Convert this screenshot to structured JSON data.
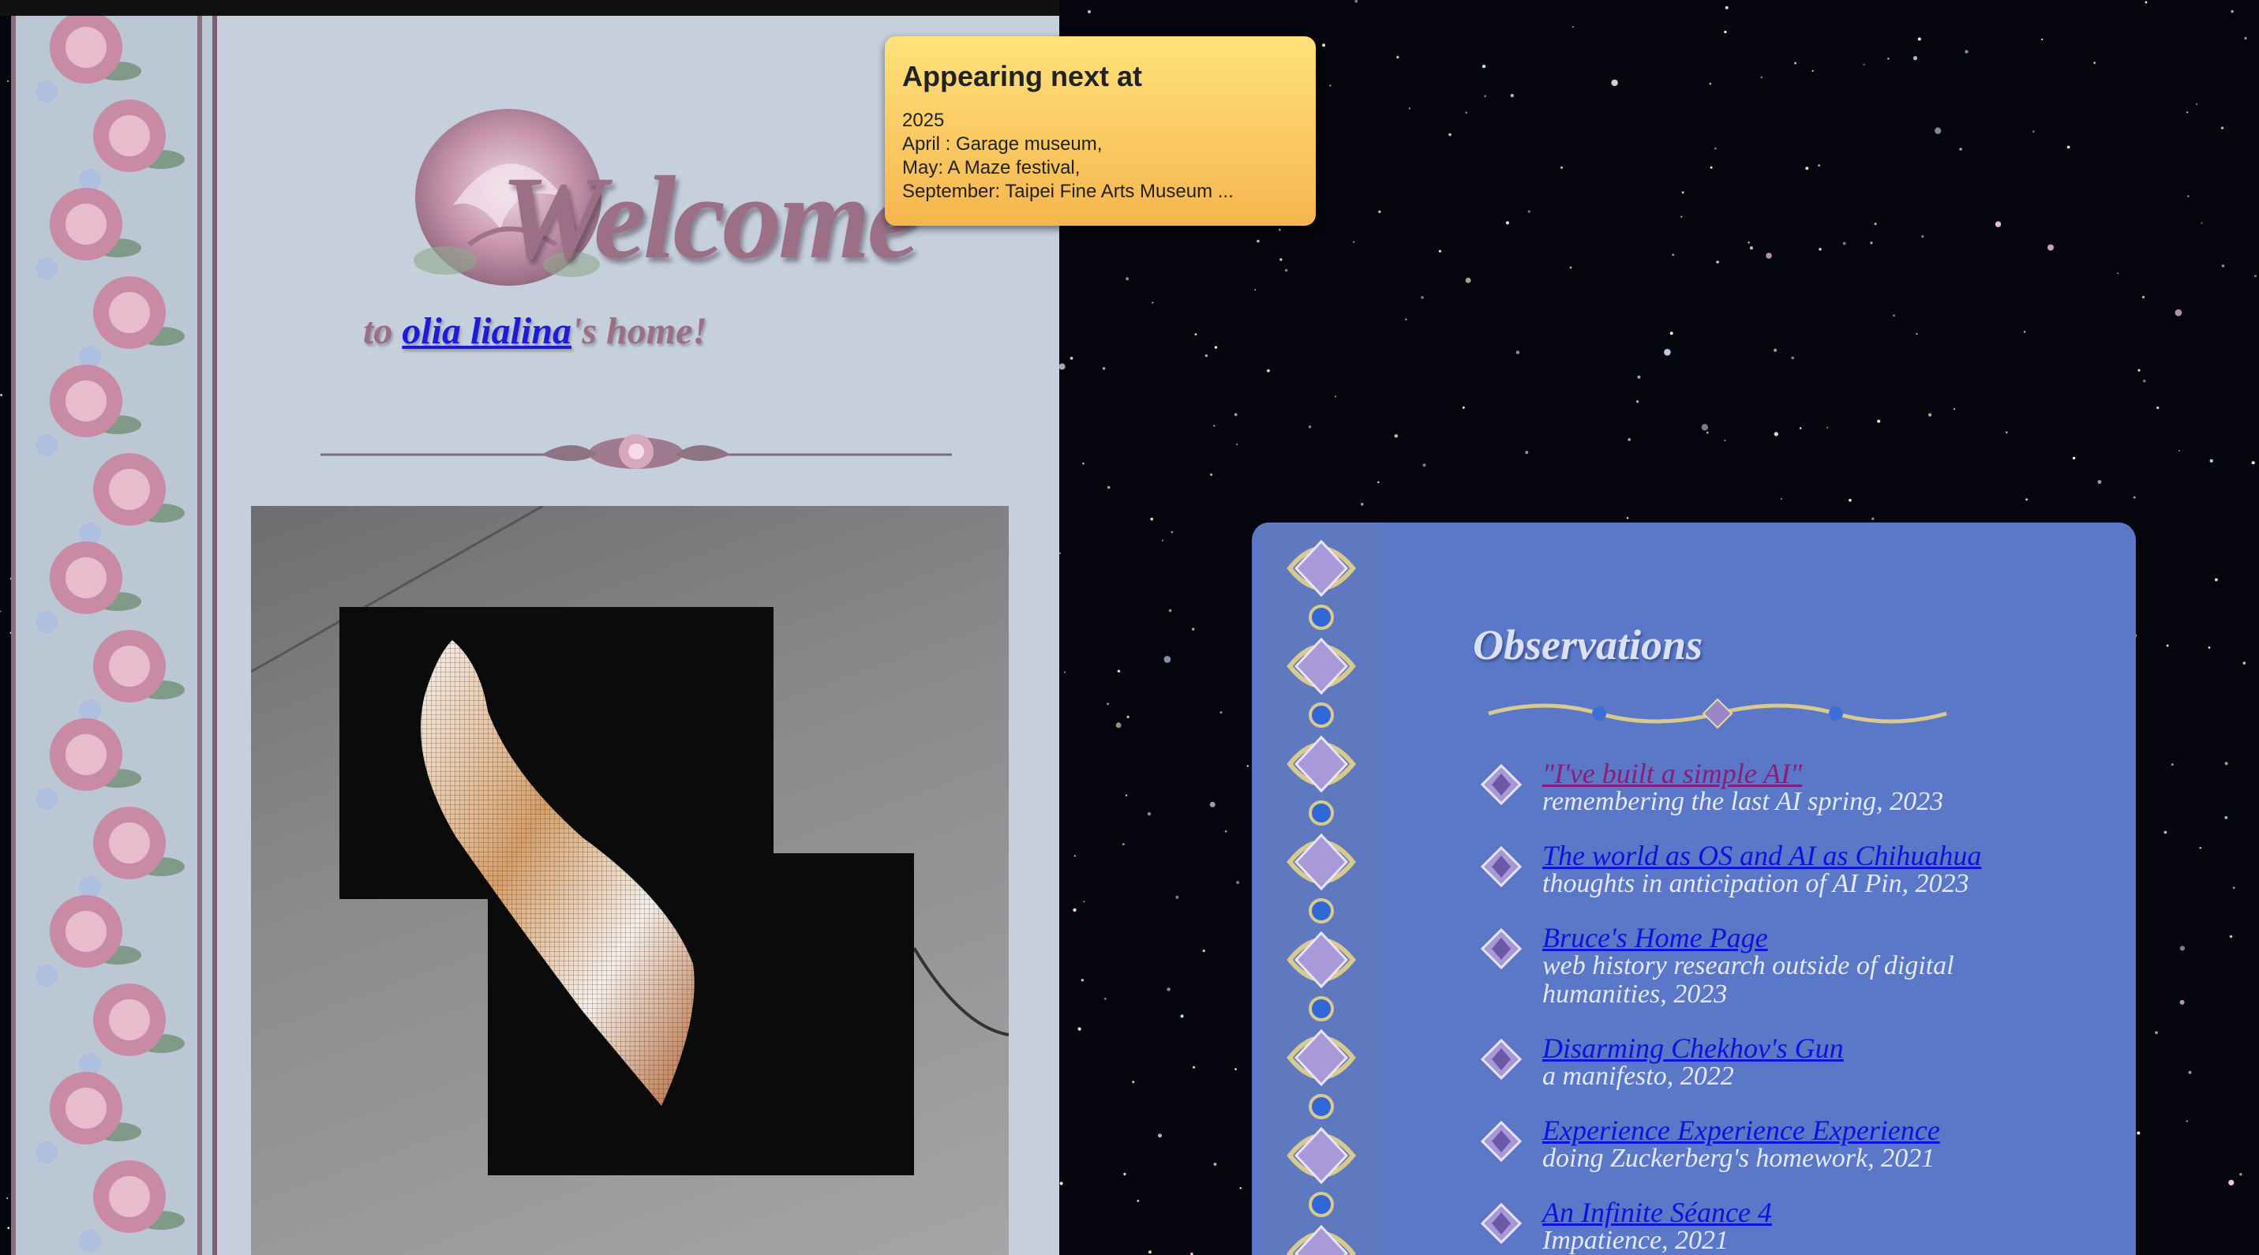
{
  "welcome": {
    "heading": "Welcome",
    "subtitle_prefix": "to ",
    "owner_link": "olia lialina",
    "subtitle_suffix": "'s home!"
  },
  "announcement": {
    "title": "Appearing next at",
    "lines": [
      "2025",
      "April : Garage museum,",
      "May: A Maze festival,",
      "September: Taipei Fine Arts Museum ..."
    ]
  },
  "observations": {
    "title": "Observations",
    "items": [
      {
        "link": "\"I've built a simple AI\"",
        "desc": "remembering the last AI spring, 2023",
        "visited": true
      },
      {
        "link": "The world as OS and AI as Chihuahua",
        "desc": "thoughts in anticipation of AI Pin, 2023",
        "visited": false
      },
      {
        "link": "Bruce's Home Page",
        "desc": "web history research outside of digital humanities, 2023",
        "visited": false
      },
      {
        "link": "Disarming Chekhov's Gun",
        "desc": "a manifesto, 2022",
        "visited": false
      },
      {
        "link": "Experience Experience Experience",
        "desc": "doing Zuckerberg's homework, 2021",
        "visited": false
      },
      {
        "link": "An Infinite Séance 4",
        "desc": "Impatience, 2021",
        "visited": false
      }
    ]
  },
  "colors": {
    "left_panel_bg": "#c5d0dc",
    "obs_panel_bg": "#5b78c8",
    "link": "#1010e0",
    "visited_link": "#8c1c7c",
    "tooltip_top": "#ffe27a",
    "tooltip_bottom": "#f6b54e"
  }
}
